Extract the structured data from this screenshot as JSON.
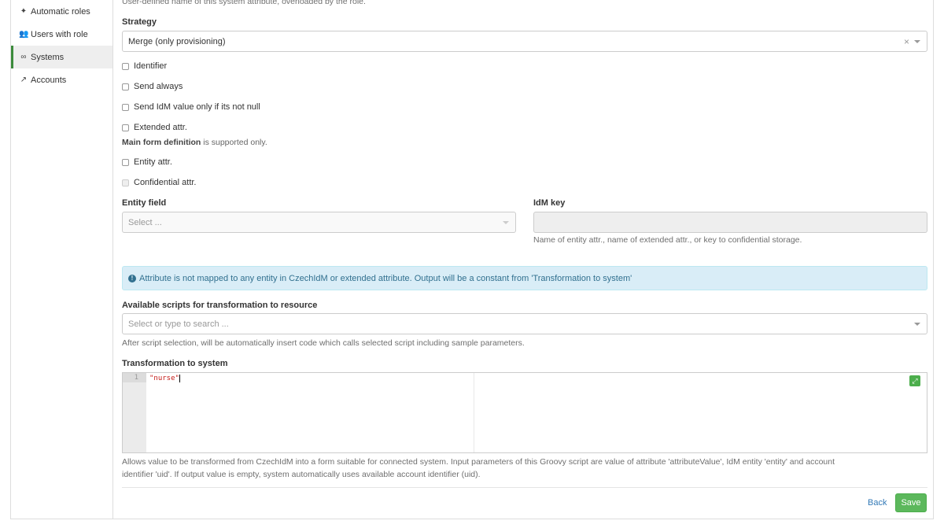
{
  "sidebar": {
    "items": [
      {
        "label": "Automatic roles",
        "icon": "magic-wand-icon",
        "active": false
      },
      {
        "label": "Users with role",
        "icon": "users-icon",
        "active": false
      },
      {
        "label": "Systems",
        "icon": "link-icon",
        "active": true
      },
      {
        "label": "Accounts",
        "icon": "external-link-icon",
        "active": false
      }
    ]
  },
  "form": {
    "top_help": "User-defined name of this system attribute, overloaded by the role.",
    "strategy_label": "Strategy",
    "strategy_value": "Merge (only provisioning)",
    "clear_symbol": "×",
    "checkboxes": {
      "identifier": "Identifier",
      "send_always": "Send always",
      "send_not_null": "Send IdM value only if its not null",
      "extended_attr": "Extended attr.",
      "entity_attr": "Entity attr.",
      "confidential_attr": "Confidential attr."
    },
    "main_form_bold": "Main form definition",
    "main_form_rest": " is supported only.",
    "entity_field_label": "Entity field",
    "entity_field_placeholder": "Select ...",
    "idm_key_label": "IdM key",
    "idm_key_help": "Name of entity attr., name of extended attr., or key to confidential storage.",
    "alert_text": "Attribute is not mapped to any entity in CzechIdM or extended attribute. Output will be a constant from 'Transformation to system'",
    "scripts_label": "Available scripts for transformation to resource",
    "scripts_placeholder": "Select or type to search ...",
    "scripts_help": "After script selection, will be automatically insert code which calls selected script including sample parameters.",
    "transformation_label": "Transformation to system",
    "editor_line_number": "1",
    "editor_code": "\"nurse\"",
    "transformation_help_line1": "Allows value to be transformed from CzechIdM into a form suitable for connected system. Input parameters of this Groovy script are value of attribute 'attributeValue', IdM entity 'entity' and account",
    "transformation_help_line2": "identifier 'uid'. If output value is empty, system automatically uses available account identifier (uid)."
  },
  "actions": {
    "back_label": "Back",
    "save_label": "Save"
  },
  "colors": {
    "accent_green": "#5cb85c",
    "info_blue": "#31708f",
    "link_blue": "#337ab7"
  }
}
